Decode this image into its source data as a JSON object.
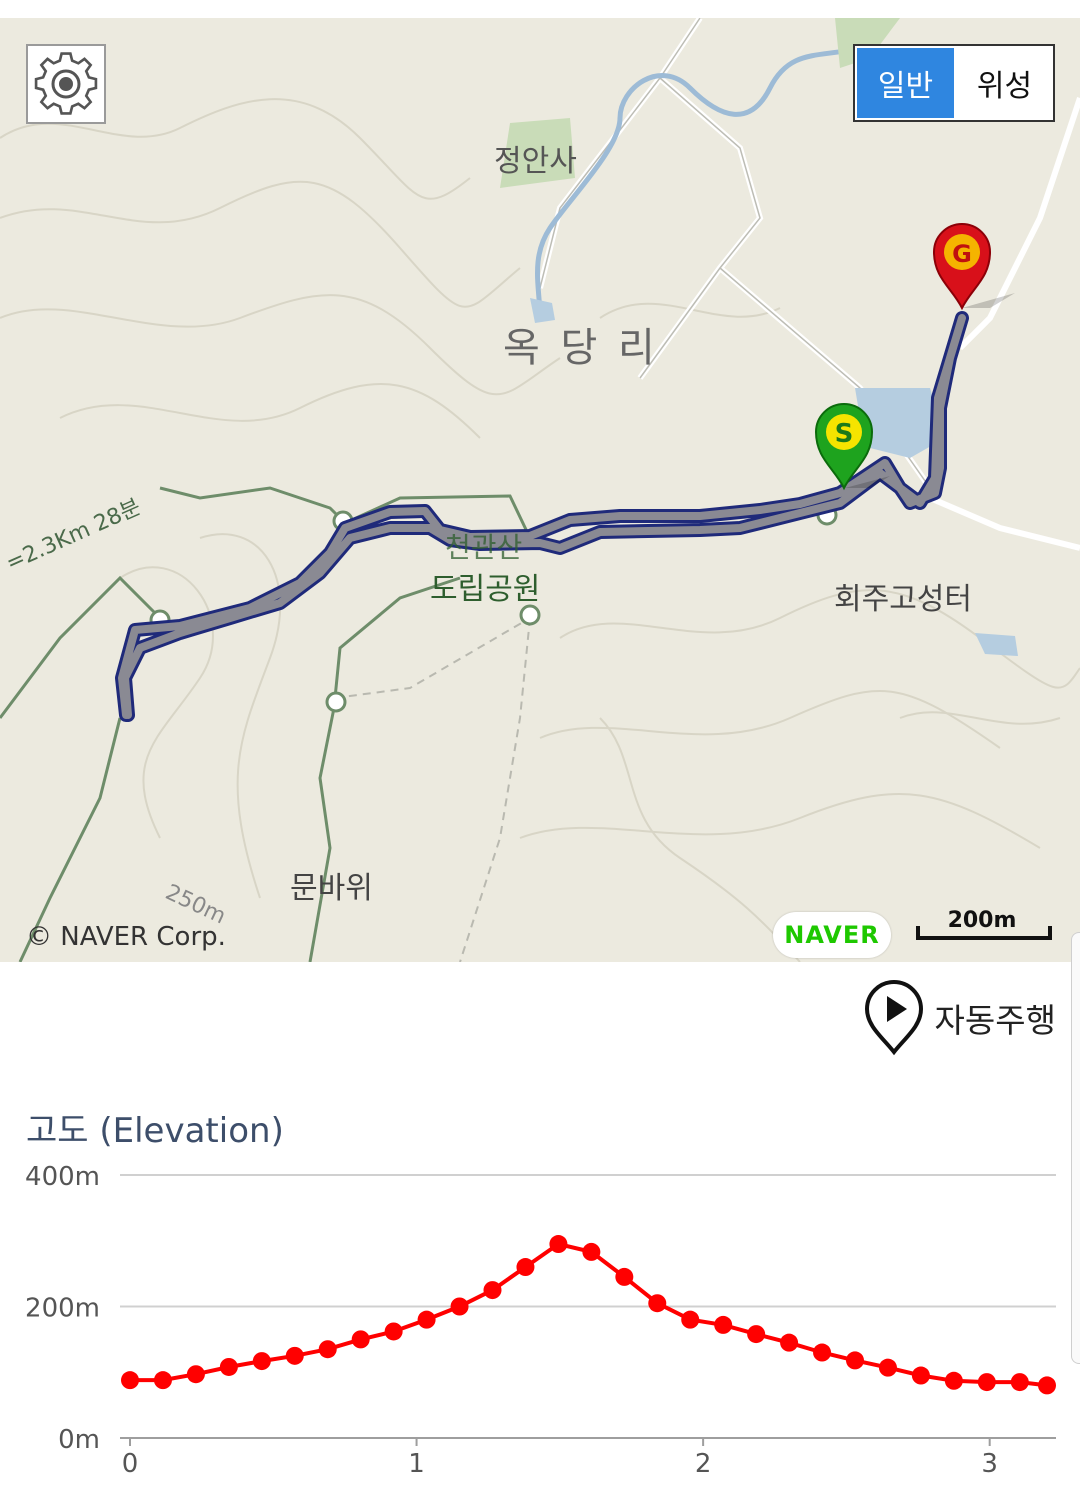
{
  "map": {
    "type_toggle": {
      "normal_label": "일반",
      "satellite_label": "위성",
      "selected": "일반"
    },
    "place_labels": {
      "temple": "정안사",
      "village": "옥 당 리",
      "fortress": "회주고성터",
      "park": "도립공원",
      "park_partial": "천관산",
      "rock": "문바위",
      "trail_annotation": "=2.3Km 28분",
      "contour": "250m"
    },
    "markers": {
      "start": "S",
      "goal": "G"
    },
    "copyright": "© NAVER Corp.",
    "logo": "NAVER",
    "scale_label": "200m",
    "colors": {
      "route": "#8a8a93",
      "route_outline": "#1f2a7a",
      "trail": "#6e8d6a",
      "water": "#b5cde0"
    }
  },
  "autoplay": {
    "label": "자동주행"
  },
  "elevation": {
    "title": "고도 (Elevation)"
  },
  "chart_data": {
    "type": "line",
    "title": "고도 (Elevation)",
    "xlabel": "",
    "ylabel": "",
    "x_ticks": [
      "0",
      "1",
      "2",
      "3"
    ],
    "y_ticks": [
      "0m",
      "200m",
      "400m"
    ],
    "xlim": [
      0,
      3.2
    ],
    "ylim": [
      0,
      400
    ],
    "grid": true,
    "color": "#ff0000",
    "series": [
      {
        "x": [
          0,
          0.115,
          0.23,
          0.345,
          0.46,
          0.575,
          0.69,
          0.805,
          0.92,
          1.035,
          1.15,
          1.265,
          1.38,
          1.495,
          1.61,
          1.725,
          1.84,
          1.955,
          2.07,
          2.185,
          2.3,
          2.415,
          2.53,
          2.645,
          2.76,
          2.875,
          2.99,
          3.105,
          3.2
        ],
        "values": [
          88,
          88,
          97,
          108,
          117,
          125,
          135,
          150,
          162,
          180,
          200,
          225,
          260,
          295,
          283,
          245,
          205,
          180,
          172,
          158,
          145,
          130,
          118,
          107,
          95,
          87,
          85,
          85,
          80
        ]
      }
    ]
  }
}
